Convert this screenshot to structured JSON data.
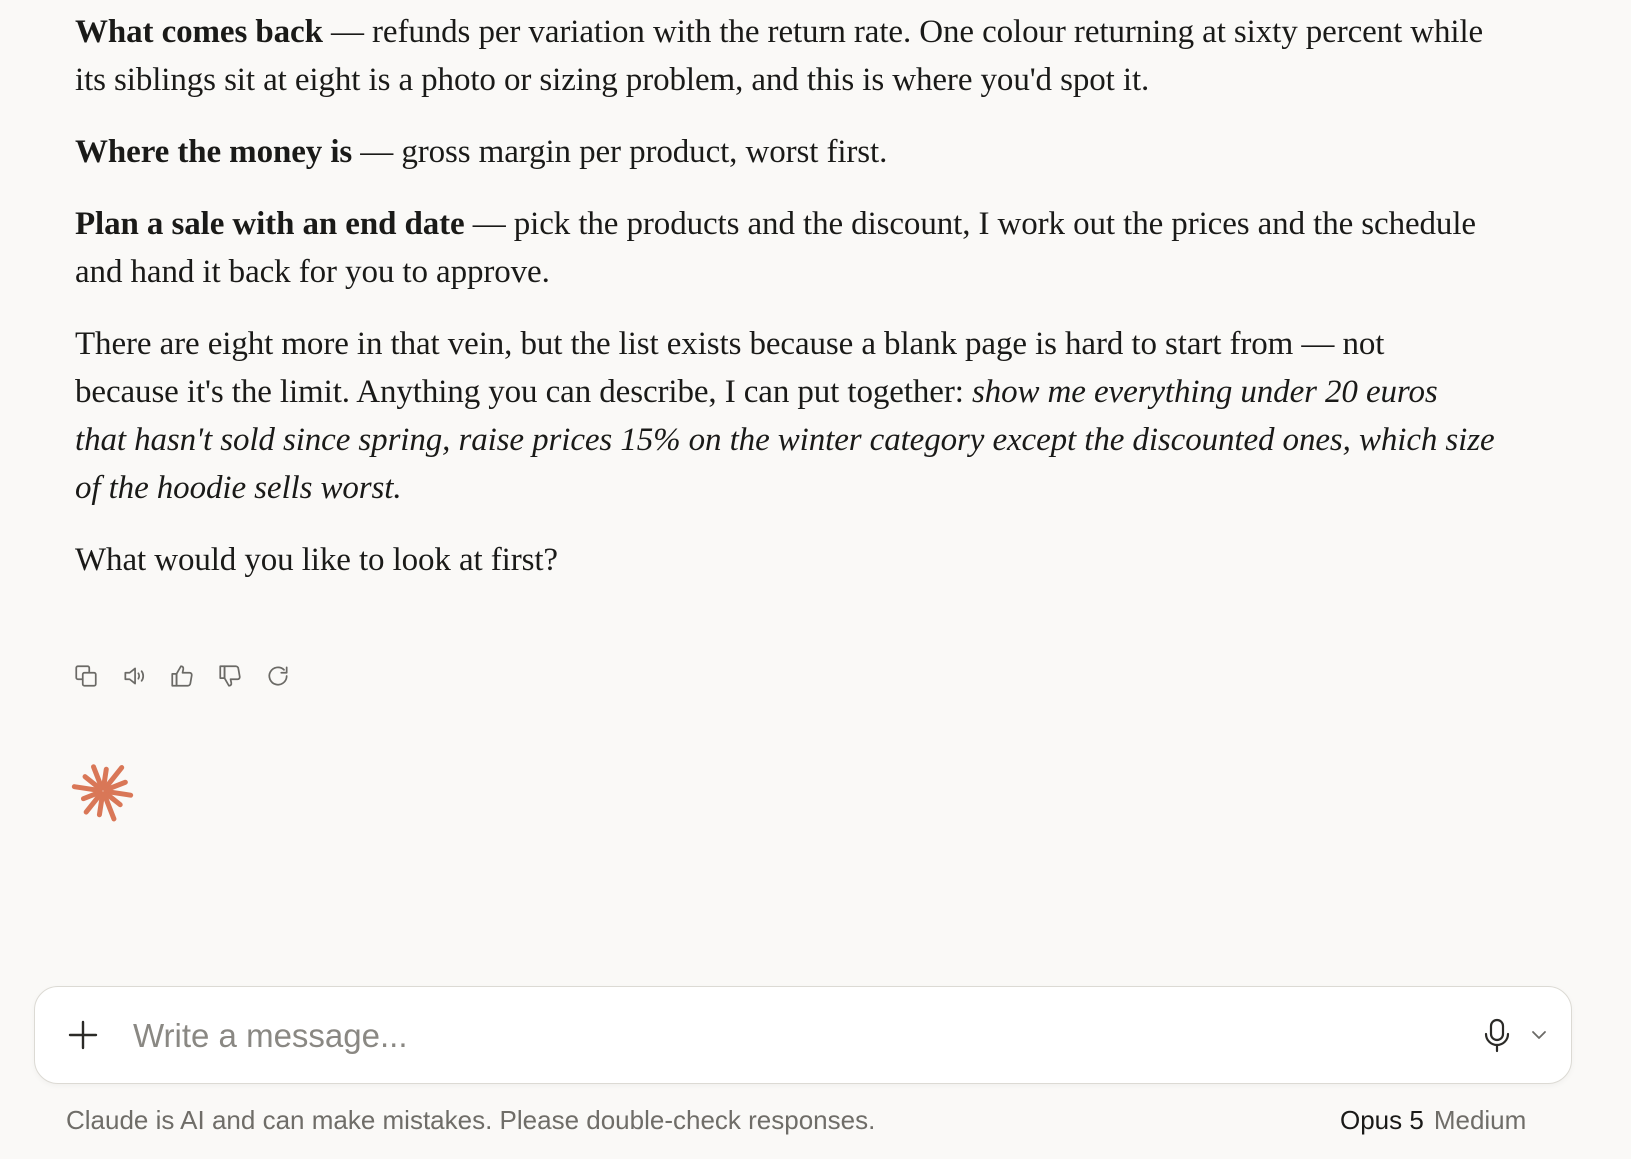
{
  "message": {
    "p1": {
      "bold": "What comes back",
      "rest": " — refunds per variation with the return rate. One colour returning at sixty percent while its siblings sit at eight is a photo or sizing problem, and this is where you'd spot it."
    },
    "p2": {
      "bold": "Where the money is",
      "rest": " — gross margin per product, worst first."
    },
    "p3": {
      "bold": "Plan a sale with an end date",
      "rest": " — pick the products and the discount, I work out the prices and the schedule and hand it back for you to approve."
    },
    "p4": {
      "text": "There are eight more in that vein, but the list exists because a blank page is hard to start from — not because it's the limit. Anything you can describe, I can put together: ",
      "italic": "show me everything under 20 euros that hasn't sold since spring, raise prices 15% on the winter category except the discounted ones, which size of the hoodie sells worst."
    },
    "p5": "What would you like to look at first?"
  },
  "actions": {
    "icons": [
      "copy-icon",
      "read-aloud-icon",
      "thumbs-up-icon",
      "thumbs-down-icon",
      "retry-icon"
    ]
  },
  "logo": {
    "icon": "claude-spark-icon",
    "color": "#d97757"
  },
  "composer": {
    "placeholder": "Write a message...",
    "plus_icon": "plus-icon",
    "mic_icon": "microphone-icon",
    "chevron_icon": "chevron-down-icon"
  },
  "footer": {
    "disclaimer": "Claude is AI and can make mistakes. Please double-check responses.",
    "model": "Opus 5",
    "effort": "Medium"
  }
}
